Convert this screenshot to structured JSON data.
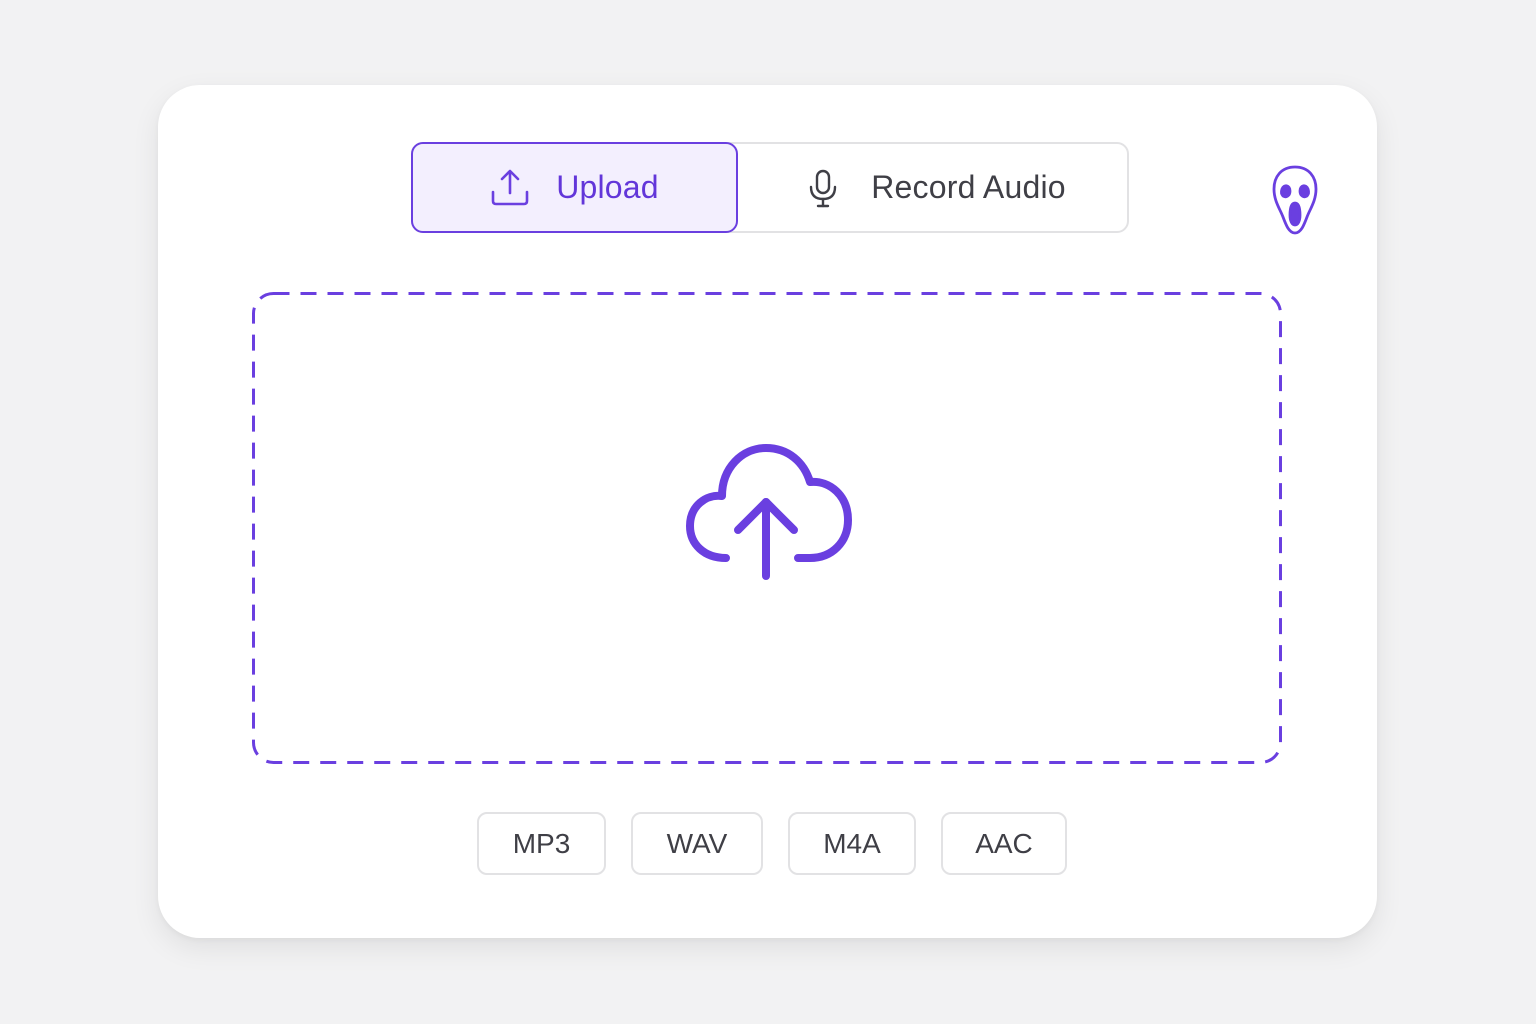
{
  "tabs": {
    "upload_label": "Upload",
    "record_label": "Record Audio",
    "active": "upload"
  },
  "icons": {
    "upload_tab": "upload-tray-icon",
    "record_tab": "microphone-icon",
    "corner": "ghostface-mask-icon",
    "dropzone": "cloud-upload-icon"
  },
  "formats": [
    "MP3",
    "WAV",
    "M4A",
    "AAC"
  ],
  "colors": {
    "accent": "#6a3fe0",
    "accent_bg": "#f3effe",
    "text": "#3f3f46",
    "border": "#e2e2e4",
    "page_bg": "#f2f2f3"
  }
}
